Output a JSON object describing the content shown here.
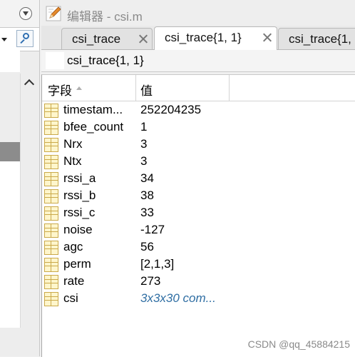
{
  "editor": {
    "title": "编辑器 - csi.m",
    "tabs": [
      {
        "label": "csi_trace"
      },
      {
        "label": "csi_trace{1, 1}"
      },
      {
        "label": "csi_trace{1,"
      }
    ],
    "variable_path": "csi_trace{1, 1}"
  },
  "table": {
    "columns": {
      "field": "字段",
      "value": "值"
    },
    "rows": [
      {
        "field": "timestam...",
        "value": "252204235"
      },
      {
        "field": "bfee_count",
        "value": "1"
      },
      {
        "field": "Nrx",
        "value": "3"
      },
      {
        "field": "Ntx",
        "value": "3"
      },
      {
        "field": "rssi_a",
        "value": "34"
      },
      {
        "field": "rssi_b",
        "value": "38"
      },
      {
        "field": "rssi_c",
        "value": "33"
      },
      {
        "field": "noise",
        "value": "-127"
      },
      {
        "field": "agc",
        "value": "56"
      },
      {
        "field": "perm",
        "value": "[2,1,3]"
      },
      {
        "field": "rate",
        "value": "273"
      },
      {
        "field": "csi",
        "value": "3x3x30 com..."
      }
    ]
  },
  "watermark": "CSDN @qq_45884215",
  "icons": {
    "editor": "pencil-icon",
    "field_type": "struct-field-icon",
    "search": "search-icon",
    "collapse": "chevron-down-circle-icon"
  },
  "colors": {
    "complex_value": "#2f6ea3",
    "struct_icon": "#c9a94a"
  }
}
